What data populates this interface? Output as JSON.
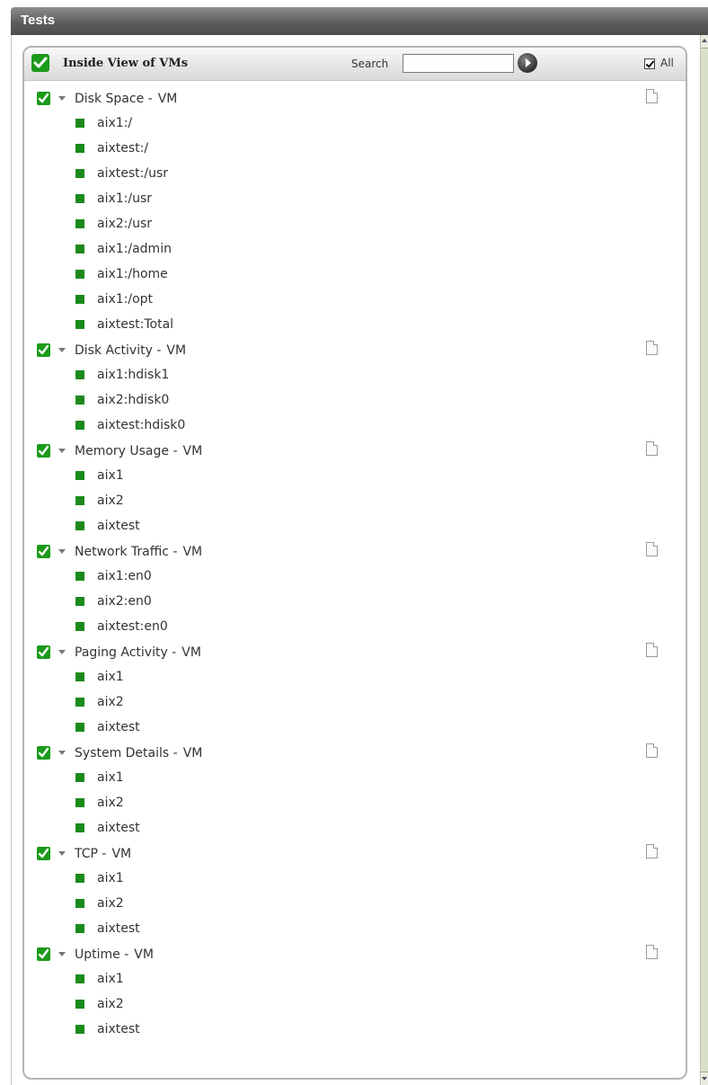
{
  "window": {
    "title": "Tests"
  },
  "panel": {
    "title": "Inside View of VMs",
    "search_label": "Search",
    "search_value": "",
    "all_label": "All",
    "all_checked": true
  },
  "colors": {
    "check_green": "#1b9a1b",
    "item_green": "#1b8a1b",
    "titlebar": "#5a5a5a"
  },
  "groups": [
    {
      "name": "Disk Space -",
      "vm": "VM",
      "items": [
        "aix1:/",
        "aixtest:/",
        "aixtest:/usr",
        "aix1:/usr",
        "aix2:/usr",
        "aix1:/admin",
        "aix1:/home",
        "aix1:/opt",
        "aixtest:Total"
      ]
    },
    {
      "name": "Disk Activity -",
      "vm": "VM",
      "items": [
        "aix1:hdisk1",
        "aix2:hdisk0",
        "aixtest:hdisk0"
      ]
    },
    {
      "name": "Memory Usage -",
      "vm": "VM",
      "items": [
        "aix1",
        "aix2",
        "aixtest"
      ]
    },
    {
      "name": "Network Traffic -",
      "vm": "VM",
      "items": [
        "aix1:en0",
        "aix2:en0",
        "aixtest:en0"
      ]
    },
    {
      "name": "Paging Activity -",
      "vm": "VM",
      "items": [
        "aix1",
        "aix2",
        "aixtest"
      ]
    },
    {
      "name": "System Details -",
      "vm": "VM",
      "items": [
        "aix1",
        "aix2",
        "aixtest"
      ]
    },
    {
      "name": "TCP -",
      "vm": "VM",
      "items": [
        "aix1",
        "aix2",
        "aixtest"
      ]
    },
    {
      "name": "Uptime -",
      "vm": "VM",
      "items": [
        "aix1",
        "aix2",
        "aixtest"
      ]
    }
  ]
}
